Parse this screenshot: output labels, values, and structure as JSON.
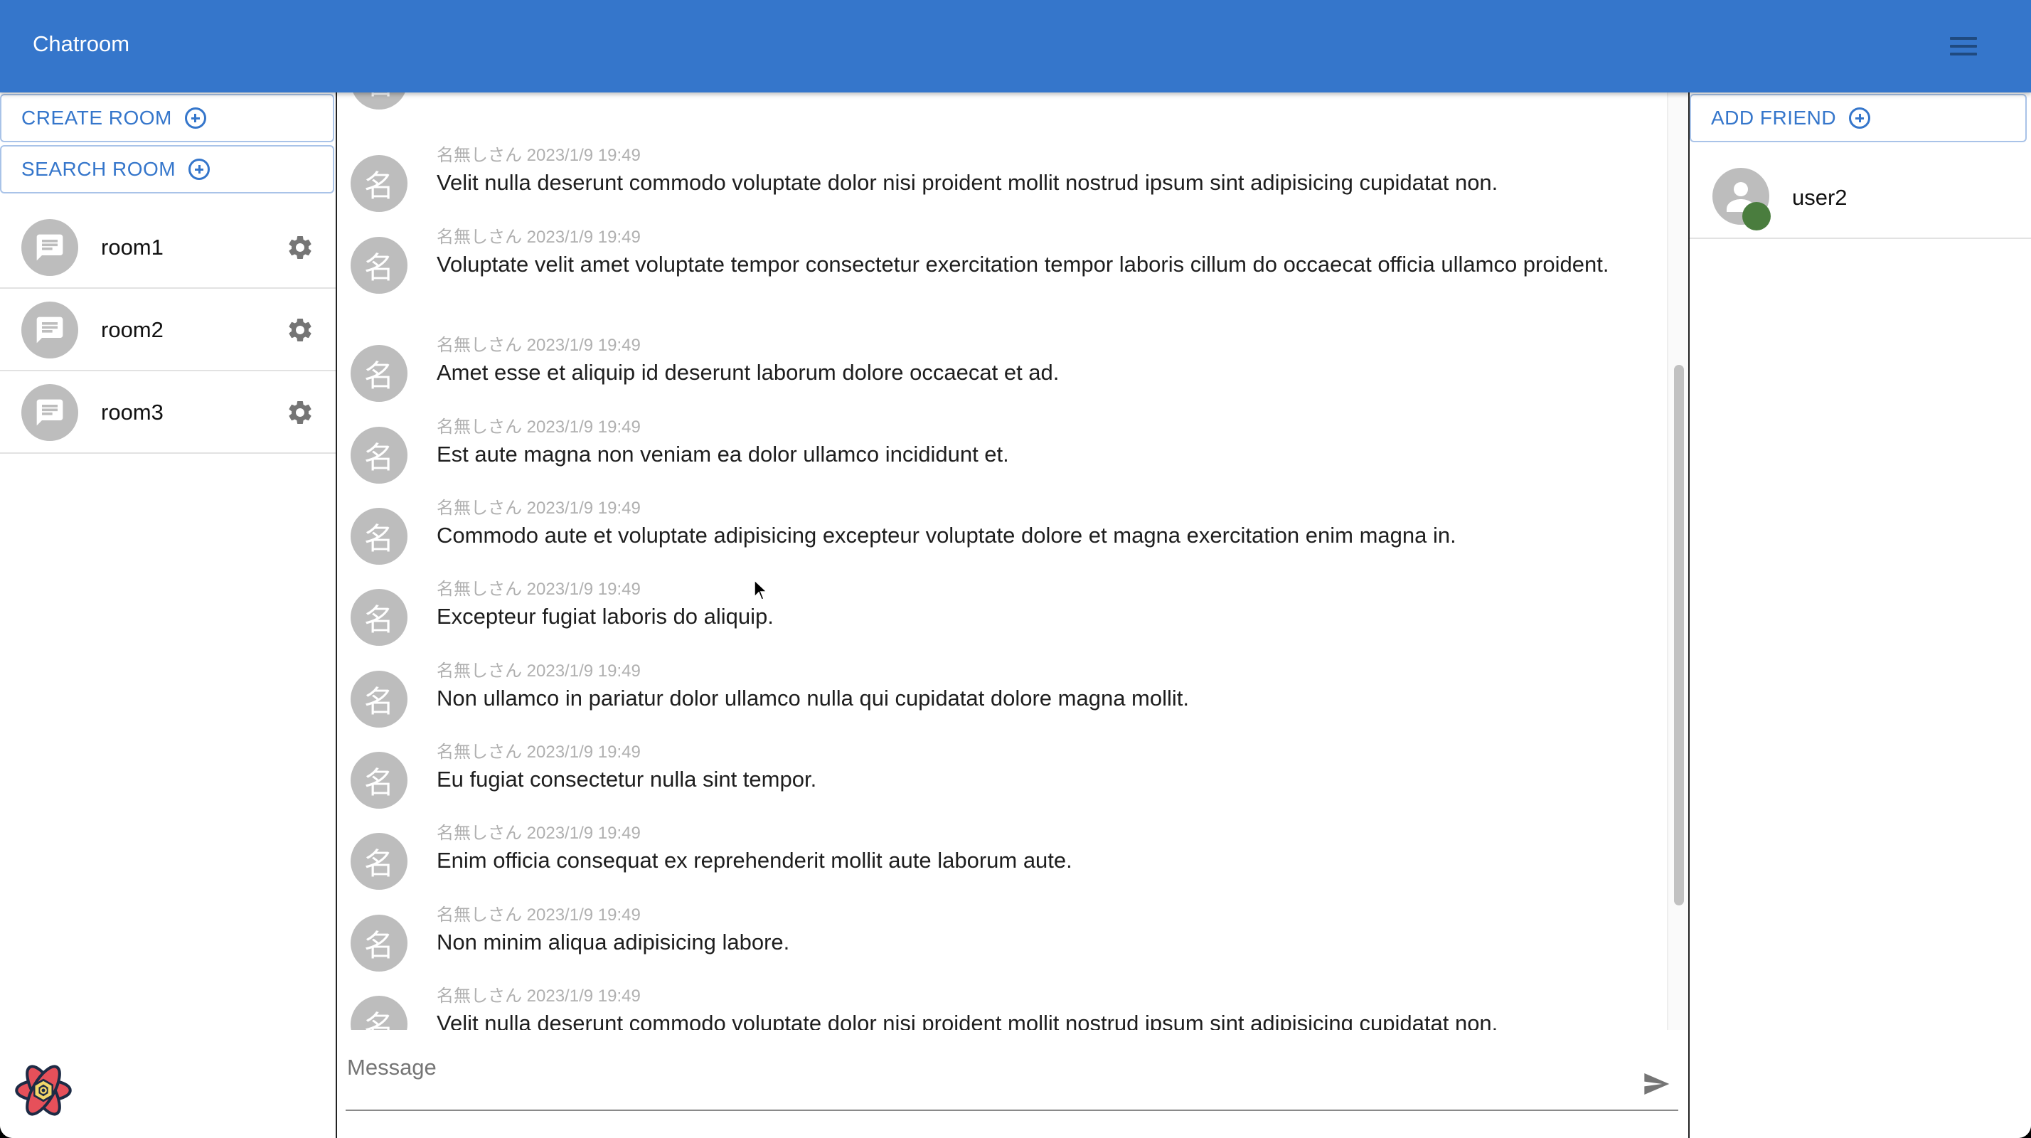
{
  "header": {
    "title": "Chatroom",
    "menu_icon": "hamburger-menu-icon"
  },
  "left_panel": {
    "create_room_label": "CREATE ROOM",
    "search_room_label": "SEARCH ROOM",
    "rooms": [
      {
        "name": "room1"
      },
      {
        "name": "room2"
      },
      {
        "name": "room3"
      }
    ]
  },
  "chat": {
    "messages": [
      {
        "avatar": "名",
        "meta": "",
        "text": "Non minim aliqua adipisicing labore."
      },
      {
        "avatar": "名",
        "meta": "名無しさん 2023/1/9 19:49",
        "text": "Velit nulla deserunt commodo voluptate dolor nisi proident mollit nostrud ipsum sint adipisicing cupidatat non."
      },
      {
        "avatar": "名",
        "meta": "名無しさん 2023/1/9 19:49",
        "text": "Voluptate velit amet voluptate tempor consectetur exercitation tempor laboris cillum do occaecat officia ullamco proident."
      },
      {
        "avatar": "名",
        "meta": "名無しさん 2023/1/9 19:49",
        "text": "Amet esse et aliquip id deserunt laborum dolore occaecat et ad."
      },
      {
        "avatar": "名",
        "meta": "名無しさん 2023/1/9 19:49",
        "text": "Est aute magna non veniam ea dolor ullamco incididunt et."
      },
      {
        "avatar": "名",
        "meta": "名無しさん 2023/1/9 19:49",
        "text": "Commodo aute et voluptate adipisicing excepteur voluptate dolore et magna exercitation enim magna in."
      },
      {
        "avatar": "名",
        "meta": "名無しさん 2023/1/9 19:49",
        "text": "Excepteur fugiat laboris do aliquip."
      },
      {
        "avatar": "名",
        "meta": "名無しさん 2023/1/9 19:49",
        "text": "Non ullamco in pariatur dolor ullamco nulla qui cupidatat dolore magna mollit."
      },
      {
        "avatar": "名",
        "meta": "名無しさん 2023/1/9 19:49",
        "text": "Eu fugiat consectetur nulla sint tempor."
      },
      {
        "avatar": "名",
        "meta": "名無しさん 2023/1/9 19:49",
        "text": "Enim officia consequat ex reprehenderit mollit aute laborum aute."
      },
      {
        "avatar": "名",
        "meta": "名無しさん 2023/1/9 19:49",
        "text": "Non minim aliqua adipisicing labore."
      },
      {
        "avatar": "名",
        "meta": "名無しさん 2023/1/9 19:49",
        "text": "Velit nulla deserunt commodo voluptate dolor nisi proident mollit nostrud ipsum sint adipisicing cupidatat non."
      }
    ],
    "input": {
      "placeholder": "Message",
      "value": ""
    }
  },
  "right_panel": {
    "add_friend_label": "ADD FRIEND",
    "friends": [
      {
        "name": "user2",
        "status": "online"
      }
    ]
  },
  "colors": {
    "primary": "#3576cb",
    "online": "#4a7d3e",
    "avatar_bg": "#bdbdbd"
  }
}
